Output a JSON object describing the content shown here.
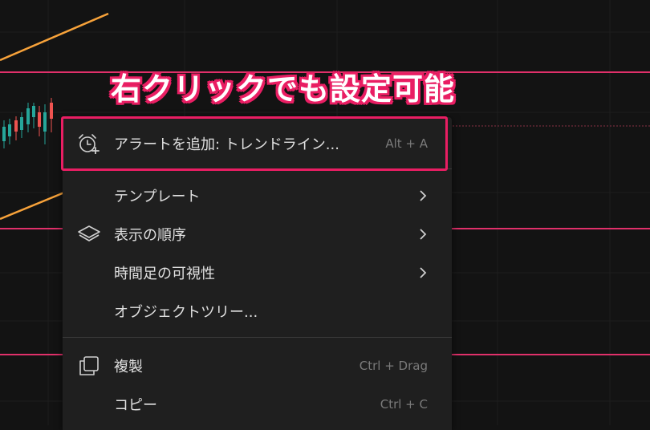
{
  "annotation": "右クリックでも設定可能",
  "menu": {
    "items": [
      {
        "label": "アラートを追加: トレンドライン...",
        "shortcut": "Alt + A",
        "icon": "alarm-clock-plus-icon"
      },
      {
        "label": "テンプレート",
        "submenu": true
      },
      {
        "label": "表示の順序",
        "submenu": true,
        "icon": "layers-icon"
      },
      {
        "label": "時間足の可視性",
        "submenu": true
      },
      {
        "label": "オブジェクトツリー..."
      },
      {
        "label": "複製",
        "shortcut": "Ctrl + Drag",
        "icon": "clone-icon"
      },
      {
        "label": "コピー",
        "shortcut": "Ctrl + C"
      }
    ]
  },
  "colors": {
    "background": "#131313",
    "menu_bg": "#1f1f1f",
    "highlight": "#e91e63",
    "trend_line": "#f7a23a",
    "horizontal_line": "#e0306a",
    "candle_up": "#26a69a",
    "candle_down": "#ef5350"
  }
}
